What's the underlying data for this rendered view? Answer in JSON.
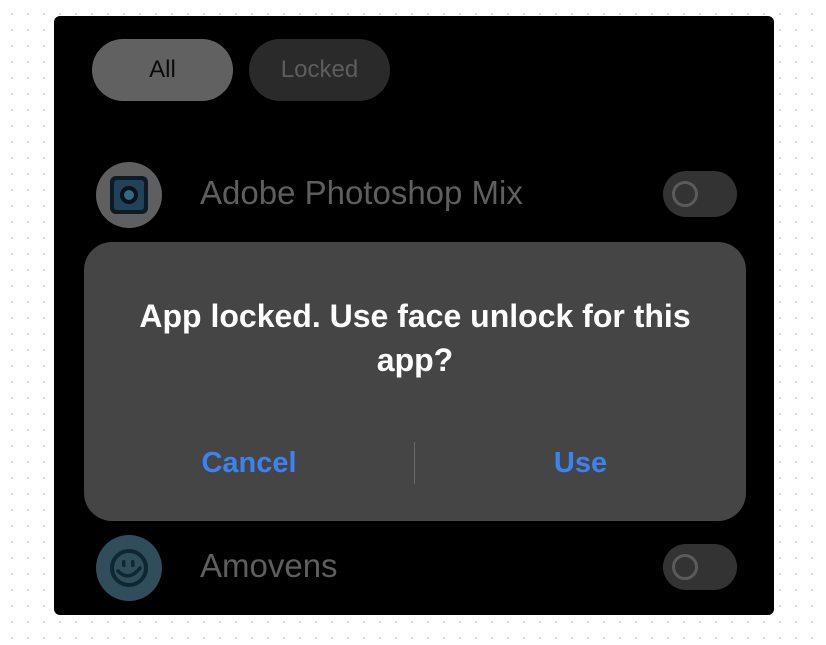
{
  "filters": {
    "all_label": "All",
    "locked_label": "Locked"
  },
  "apps": [
    {
      "name": "Adobe Photoshop Mix",
      "icon": "photoshop-mix-icon",
      "locked": false
    },
    {
      "name": "Amovens",
      "icon": "smiley-face-icon",
      "locked": false
    }
  ],
  "dialog": {
    "message": "App locked. Use face unlock for this app?",
    "cancel_label": "Cancel",
    "confirm_label": "Use"
  },
  "colors": {
    "accent": "#3d82f1",
    "dialog_background": "#454545",
    "screen_background": "#000000"
  }
}
